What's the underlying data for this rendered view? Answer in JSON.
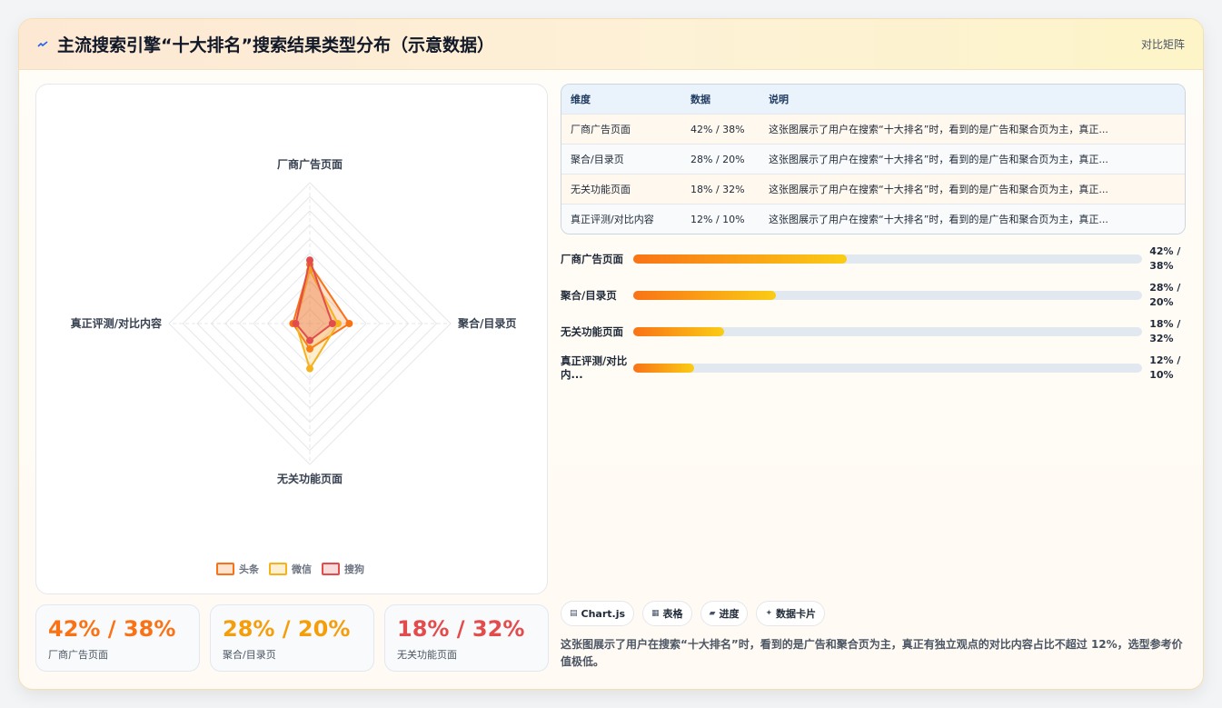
{
  "header": {
    "icon": "wave-icon",
    "title": "主流搜索引擎“十大排名”搜索结果类型分布（示意数据）",
    "right_label": "对比矩阵"
  },
  "chart_data": {
    "type": "radar",
    "axes": [
      "厂商广告页面",
      "聚合/目录页",
      "无关功能页面",
      "真正评测/对比内容"
    ],
    "series": [
      {
        "name": "头条",
        "values": [
          42,
          28,
          18,
          12
        ],
        "color": "#f97316"
      },
      {
        "name": "微信",
        "values": [
          38,
          20,
          32,
          10
        ],
        "color": "#f5b21d"
      },
      {
        "name": "搜狗",
        "values": [
          45,
          16,
          12,
          10
        ],
        "color": "#e24c4c"
      }
    ],
    "rmax": 100,
    "legend_position": "bottom",
    "grid": true
  },
  "stats": [
    {
      "value": "42% / 38%",
      "label": "厂商广告页面",
      "color": "#f97316"
    },
    {
      "value": "28% / 20%",
      "label": "聚合/目录页",
      "color": "#f59e0b"
    },
    {
      "value": "18% / 32%",
      "label": "无关功能页面",
      "color": "#e24c4c"
    }
  ],
  "table": {
    "headers": [
      "维度",
      "数据",
      "说明"
    ],
    "rows": [
      {
        "dim": "厂商广告页面",
        "data": "42% / 38%",
        "note": "这张图展示了用户在搜索“十大排名”时，看到的是广告和聚合页为主，真正..."
      },
      {
        "dim": "聚合/目录页",
        "data": "28% / 20%",
        "note": "这张图展示了用户在搜索“十大排名”时，看到的是广告和聚合页为主，真正..."
      },
      {
        "dim": "无关功能页面",
        "data": "18% / 32%",
        "note": "这张图展示了用户在搜索“十大排名”时，看到的是广告和聚合页为主，真正..."
      },
      {
        "dim": "真正评测/对比内容",
        "data": "12% / 10%",
        "note": "这张图展示了用户在搜索“十大排名”时，看到的是广告和聚合页为主，真正..."
      }
    ]
  },
  "progress": [
    {
      "label": "厂商广告页面",
      "value_text": "42% / 38%",
      "pct": 42
    },
    {
      "label": "聚合/目录页",
      "value_text": "28% / 20%",
      "pct": 28
    },
    {
      "label": "无关功能页面",
      "value_text": "18% / 32%",
      "pct": 18
    },
    {
      "label": "真正评测/对比内...",
      "value_text": "12% / 10%",
      "pct": 12
    }
  ],
  "chips": [
    {
      "icon": "chart-icon",
      "glyph": "▤",
      "label": "Chart.js"
    },
    {
      "icon": "table-icon",
      "glyph": "▦",
      "label": "表格"
    },
    {
      "icon": "progress-icon",
      "glyph": "▰",
      "label": "进度"
    },
    {
      "icon": "sparkle-icon",
      "glyph": "✦",
      "label": "数据卡片"
    }
  ],
  "description": "这张图展示了用户在搜索“十大排名”时，看到的是广告和聚合页为主，真正有独立观点的对比内容占比不超过 12%，选型参考价值极低。"
}
